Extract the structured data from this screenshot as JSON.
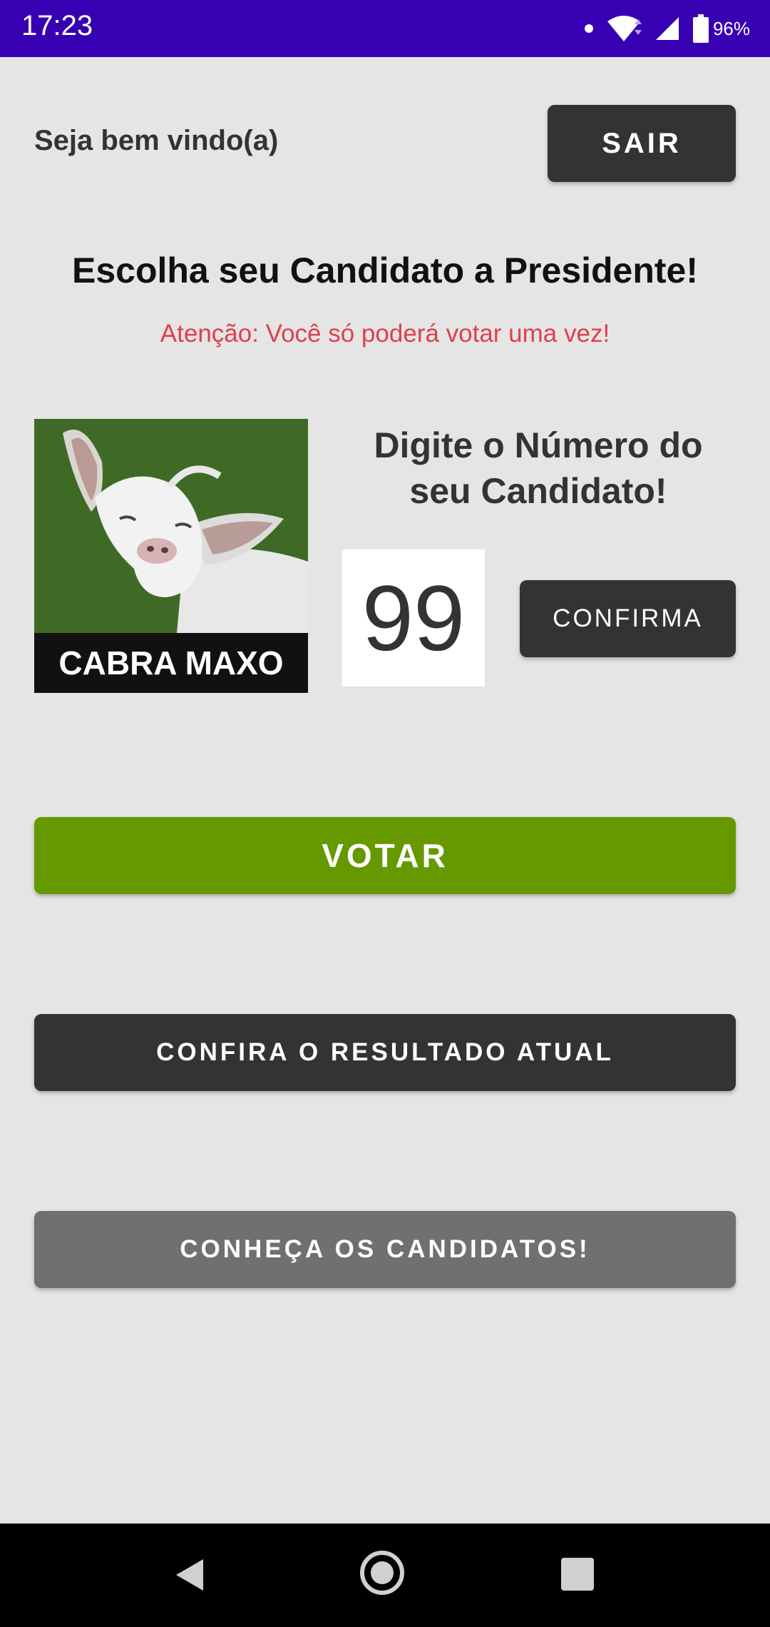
{
  "status_bar": {
    "time": "17:23",
    "battery": "96%",
    "icons": [
      "notification-dot-icon",
      "wifi-icon",
      "cellular-signal-icon",
      "battery-icon"
    ]
  },
  "header": {
    "welcome": "Seja bem vindo(a)",
    "logout_label": "SAIR"
  },
  "main": {
    "title": "Escolha seu Candidato a Presidente!",
    "warning": "Atenção: Você só poderá votar uma vez!",
    "candidate_caption": "CABRA MAXO",
    "prompt": "Digite o Número do seu Candidato!",
    "candidate_number": "99",
    "confirm_label": "CONFIRMA"
  },
  "actions": {
    "vote_label": "VOTAR",
    "results_label": "CONFIRA O RESULTADO ATUAL",
    "candidates_label": "CONHEÇA OS CANDIDATOS!"
  },
  "colors": {
    "status_bar": "#3700b3",
    "background": "#e5e5e5",
    "dark_button": "#333333",
    "vote_button": "#669900",
    "candidates_button": "#707070",
    "warning_text": "#e0404a"
  },
  "nav_bar": {
    "icons": [
      "back-icon",
      "home-icon",
      "recent-apps-icon"
    ]
  }
}
